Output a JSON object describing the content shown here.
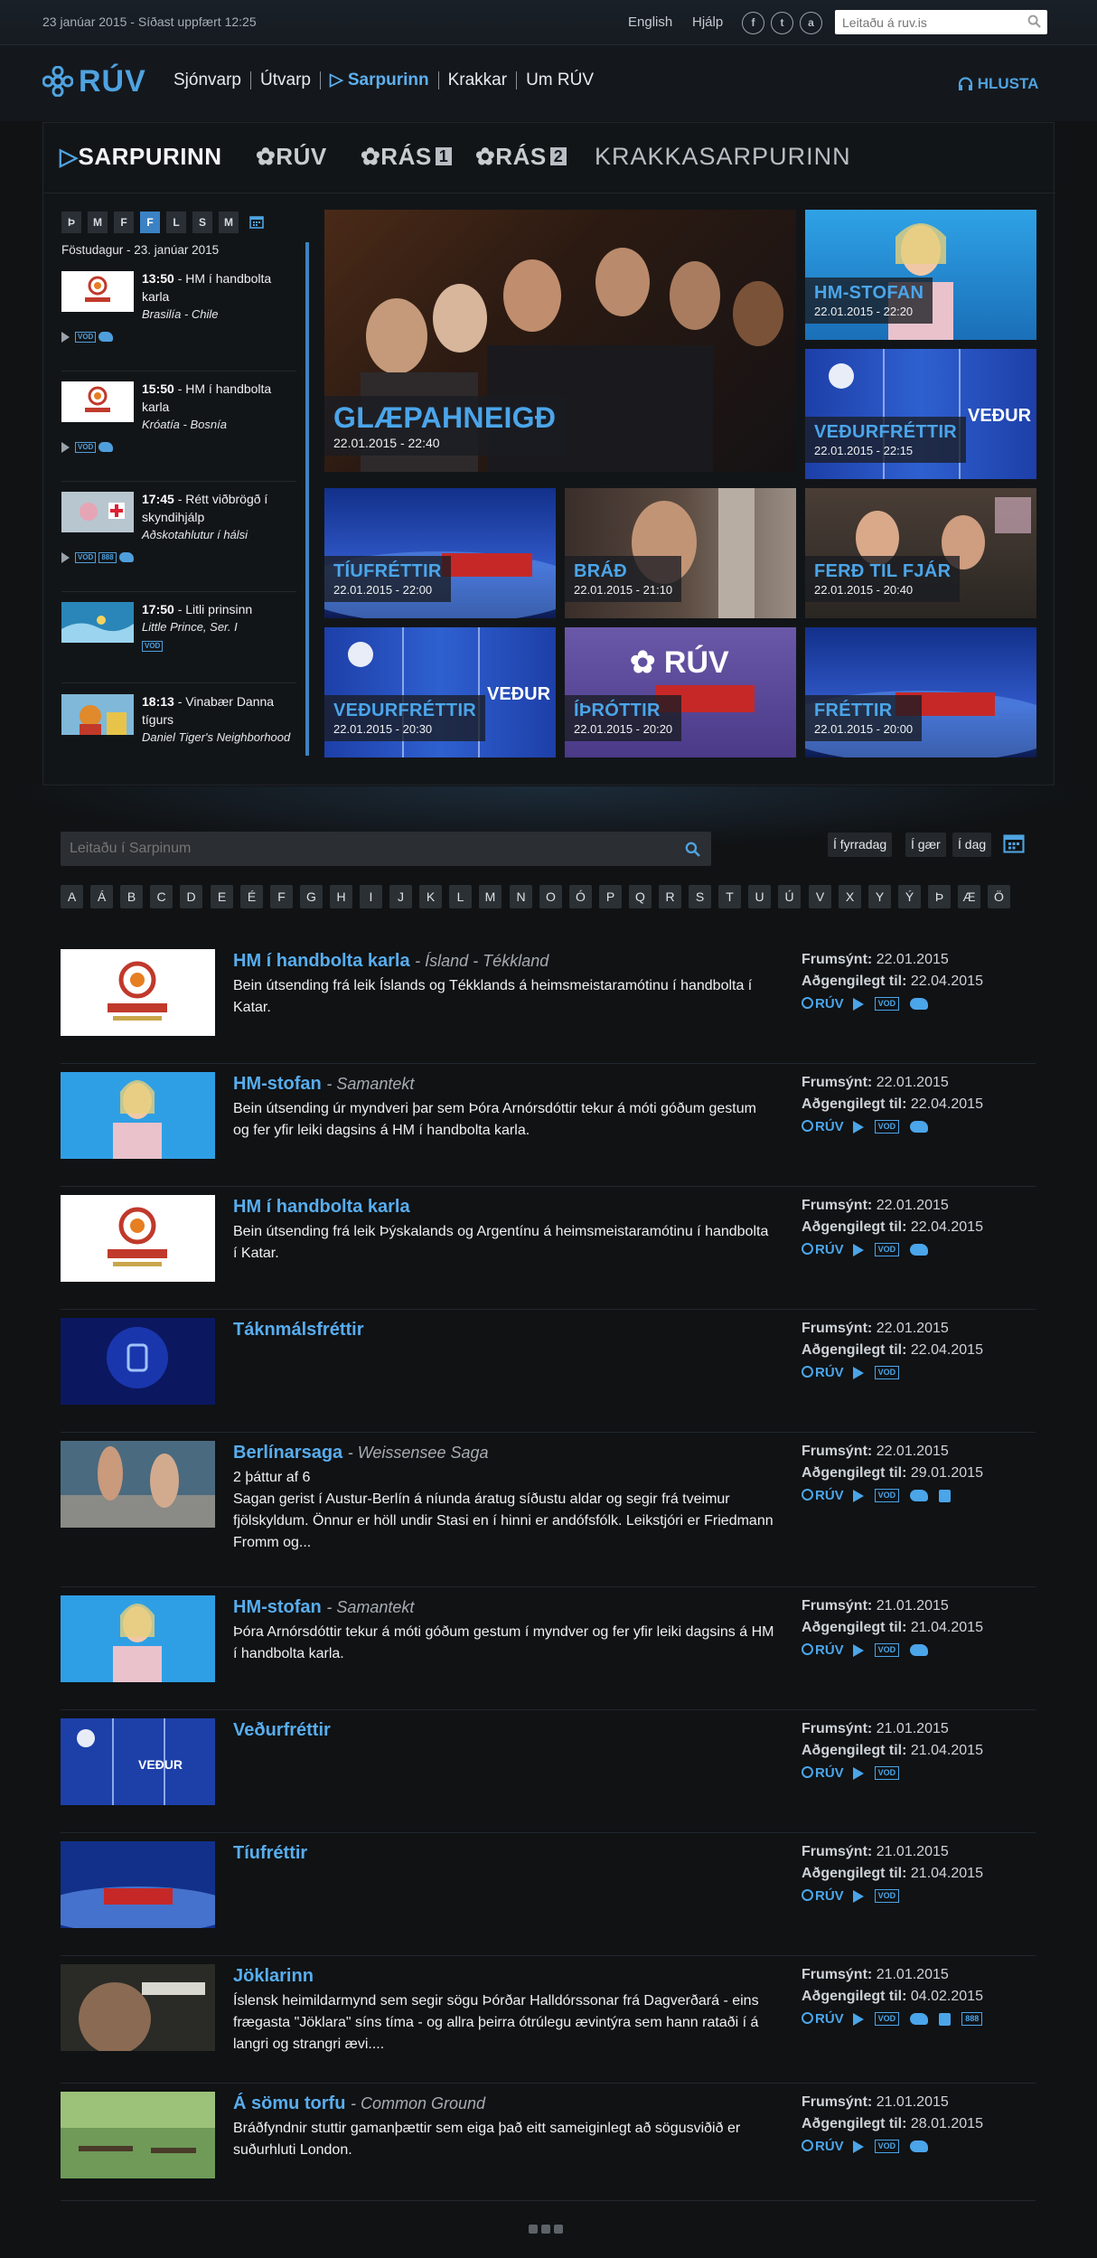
{
  "topbar": {
    "date": "23 janúar 2015 - Síðast uppfært 12:25",
    "english": "English",
    "help": "Hjálp",
    "social": [
      "f",
      "t",
      "a"
    ],
    "search_placeholder": "Leitaðu á ruv.is"
  },
  "nav": {
    "logo": "RÚV",
    "links": [
      "Sjónvarp",
      "Útvarp",
      "Sarpurinn",
      "Krakkar",
      "Um RÚV"
    ],
    "active": "Sarpurinn",
    "listen": "HLUSTA"
  },
  "panel": {
    "brands": [
      "SARPURINN",
      "RÚV",
      "RÁS",
      "1",
      "RÁS",
      "2",
      "KRAKKASARPURINN"
    ],
    "days": [
      "Þ",
      "M",
      "F",
      "F",
      "L",
      "S",
      "M"
    ],
    "selected_day": 3,
    "date_label": "Föstudagur - 23. janúar 2015",
    "schedule": [
      {
        "time": "13:50",
        "title": "HM í handbolta karla",
        "sub": "Brasilía - Chile",
        "badges": [
          "VOD"
        ]
      },
      {
        "time": "15:50",
        "title": "HM í handbolta karla",
        "sub": "Króatía - Bosnía",
        "badges": [
          "VOD"
        ]
      },
      {
        "time": "17:45",
        "title": "Rétt viðbrögð í skyndihjálp",
        "sub": "Aðskotahlutur í hálsi",
        "badges": [
          "VOD",
          "888"
        ]
      },
      {
        "time": "17:50",
        "title": "Litli prinsinn",
        "sub": "Little Prince, Ser. I",
        "badges": [
          "VOD"
        ]
      },
      {
        "time": "18:13",
        "title": "Vinabær Danna tígurs",
        "sub": "Daniel Tiger's Neighborhood",
        "badges": []
      }
    ],
    "featured": [
      {
        "name": "GLÆPAHNEIGÐ",
        "date": "22.01.2015 - 22:40"
      },
      {
        "name": "HM-STOFAN",
        "date": "22.01.2015 - 22:20"
      },
      {
        "name": "VEÐURFRÉTTIR",
        "date": "22.01.2015 - 22:15"
      },
      {
        "name": "TÍUFRÉTTIR",
        "date": "22.01.2015 - 22:00"
      },
      {
        "name": "BRÁÐ",
        "date": "22.01.2015 - 21:10"
      },
      {
        "name": "FERÐ TIL FJÁR",
        "date": "22.01.2015 - 20:40"
      },
      {
        "name": "VEÐURFRÉTTIR",
        "date": "22.01.2015 - 20:30"
      },
      {
        "name": "ÍÞRÓTTIR",
        "date": "22.01.2015 - 20:20"
      },
      {
        "name": "FRÉTTIR",
        "date": "22.01.2015 - 20:00"
      }
    ]
  },
  "search": {
    "placeholder": "Leitaðu í Sarpinum",
    "day_buttons": [
      "Í fyrradag",
      "Í gær",
      "Í dag"
    ],
    "letters": [
      "A",
      "Á",
      "B",
      "C",
      "D",
      "E",
      "É",
      "F",
      "G",
      "H",
      "I",
      "J",
      "K",
      "L",
      "M",
      "N",
      "O",
      "Ó",
      "P",
      "Q",
      "R",
      "S",
      "T",
      "U",
      "Ú",
      "V",
      "X",
      "Y",
      "Ý",
      "Þ",
      "Æ",
      "Ö"
    ]
  },
  "labels": {
    "premiere": "Frumsýnt:",
    "available": "Aðgengilegt til:",
    "channel": "RÚV"
  },
  "results": [
    {
      "title": "HM í handbolta karla",
      "orig": "Ísland - Tékkland",
      "desc": "Bein útsending frá leik Íslands og Tékklands á heimsmeistaramótinu í handbolta í Katar.",
      "premiere": "22.01.2015",
      "available": "22.04.2015",
      "icons": [
        "ruv",
        "play",
        "vod",
        "twitter"
      ]
    },
    {
      "title": "HM-stofan",
      "orig": "Samantekt",
      "desc": "Bein útsending úr myndveri þar sem Þóra Arnórsdóttir tekur á móti góðum gestum og fer yfir leiki dagsins á HM í handbolta karla.",
      "premiere": "22.01.2015",
      "available": "22.04.2015",
      "icons": [
        "ruv",
        "play",
        "vod",
        "twitter"
      ]
    },
    {
      "title": "HM í handbolta karla",
      "orig": "",
      "desc": "Bein útsending frá leik Þýskalands og Argentínu á heimsmeistaramótinu í handbolta í Katar.",
      "premiere": "22.01.2015",
      "available": "22.04.2015",
      "icons": [
        "ruv",
        "play",
        "vod",
        "twitter"
      ]
    },
    {
      "title": "Táknmálsfréttir",
      "orig": "",
      "desc": "",
      "premiere": "22.01.2015",
      "available": "22.04.2015",
      "icons": [
        "ruv",
        "play",
        "vod"
      ]
    },
    {
      "title": "Berlínarsaga",
      "orig": "Weissensee Saga",
      "desc": "2 þáttur af 6\nSagan gerist í Austur-Berlín á níunda áratug síðustu aldar og segir frá tveimur fjölskyldum. Önnur er höll undir Stasi en í hinni er andófsfólk. Leikstjóri er Friedmann Fromm og...",
      "premiere": "22.01.2015",
      "available": "29.01.2015",
      "icons": [
        "ruv",
        "play",
        "vod",
        "twitter",
        "lock"
      ]
    },
    {
      "title": "HM-stofan",
      "orig": "Samantekt",
      "desc": "Þóra Arnórsdóttir tekur á móti góðum gestum í myndver og fer yfir leiki dagsins á HM í handbolta karla.",
      "premiere": "21.01.2015",
      "available": "21.04.2015",
      "icons": [
        "ruv",
        "play",
        "vod",
        "twitter"
      ]
    },
    {
      "title": "Veðurfréttir",
      "orig": "",
      "desc": "",
      "premiere": "21.01.2015",
      "available": "21.04.2015",
      "icons": [
        "ruv",
        "play",
        "vod"
      ]
    },
    {
      "title": "Tíufréttir",
      "orig": "",
      "desc": "",
      "premiere": "21.01.2015",
      "available": "21.04.2015",
      "icons": [
        "ruv",
        "play",
        "vod"
      ]
    },
    {
      "title": "Jöklarinn",
      "orig": "",
      "desc": "Íslensk heimildarmynd sem segir sögu Þórðar Halldórssonar frá Dagverðará - eins frægasta \"Jöklara\" síns tíma - og allra þeirra ótrúlegu ævintýra sem hann rataði í á langri og strangri ævi....",
      "premiere": "21.01.2015",
      "available": "04.02.2015",
      "icons": [
        "ruv",
        "play",
        "vod",
        "twitter",
        "lock",
        "888"
      ]
    },
    {
      "title": "Á sömu torfu",
      "orig": "Common Ground",
      "desc": "Bráðfyndnir stuttir gamanþættir sem eiga það eitt sameiginlegt að sögusviðið er suðurhluti London.",
      "premiere": "21.01.2015",
      "available": "28.01.2015",
      "icons": [
        "ruv",
        "play",
        "vod",
        "twitter"
      ]
    }
  ]
}
